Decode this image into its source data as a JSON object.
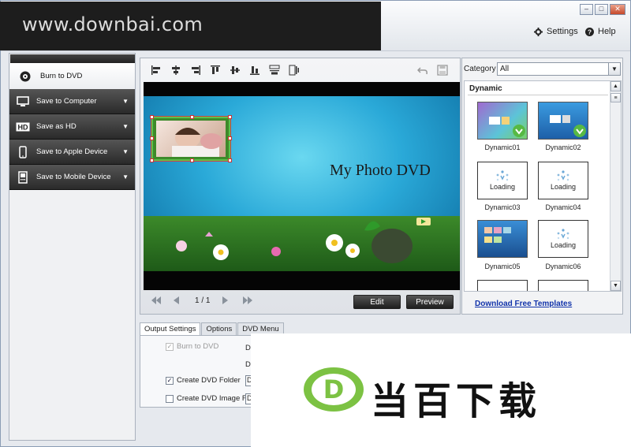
{
  "watermark": {
    "site": "www.downbai.com",
    "brand": "当百下载",
    "logo_letter": "D"
  },
  "window": {
    "minimize": "–",
    "maximize": "□",
    "close": "✕"
  },
  "header": {
    "settings_label": "Settings",
    "help_label": "Help"
  },
  "sidebar": {
    "items": [
      {
        "label": "Burn to DVD",
        "icon": "disc-icon",
        "active": true
      },
      {
        "label": "Save to Computer",
        "icon": "monitor-icon"
      },
      {
        "label": "Save as HD",
        "icon": "hd-icon"
      },
      {
        "label": "Save to Apple Device",
        "icon": "phone-icon"
      },
      {
        "label": "Save to Mobile Device",
        "icon": "mobile-icon"
      }
    ],
    "arrow": "▼"
  },
  "editor": {
    "stage_title": "My Photo DVD",
    "page_indicator": "1 / 1",
    "edit_label": "Edit",
    "preview_label": "Preview"
  },
  "templates": {
    "category_label": "Category",
    "category_value": "All",
    "section": "Dynamic",
    "loading_text": "Loading",
    "items": [
      {
        "name": "Dynamic01",
        "state": "image"
      },
      {
        "name": "Dynamic02",
        "state": "image"
      },
      {
        "name": "Dynamic03",
        "state": "loading"
      },
      {
        "name": "Dynamic04",
        "state": "loading"
      },
      {
        "name": "Dynamic05",
        "state": "image"
      },
      {
        "name": "Dynamic06",
        "state": "loading"
      }
    ],
    "download_link": "Download Free Templates"
  },
  "settings": {
    "tabs": [
      "Output Settings",
      "Options",
      "DVD Menu"
    ],
    "burn_to_dvd": "Burn to DVD",
    "create_folder": "Create DVD  Folder",
    "create_image": "Create DVD Image File",
    "field_label_1": "DV",
    "field_label_2": "Di",
    "field_value_1": "D",
    "field_value_2": "D"
  },
  "colors": {
    "accent_green": "#6cc04a",
    "sidebar_dark": "#2a2a2a",
    "link_blue": "#1133aa"
  }
}
